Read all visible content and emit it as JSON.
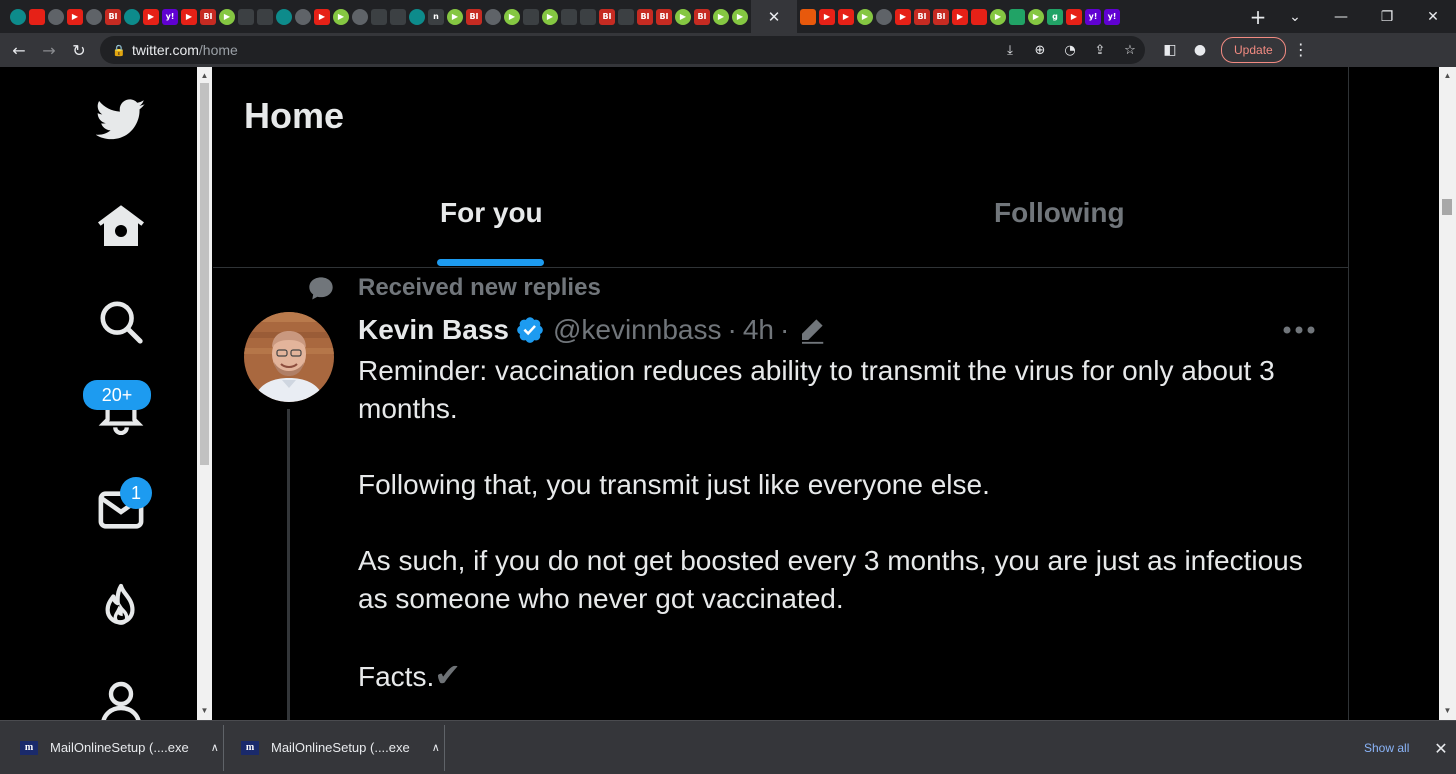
{
  "browser": {
    "tabs": [
      {
        "icon": "globe-favicon",
        "text": "",
        "cls": "teal"
      },
      {
        "icon": "red-favicon",
        "text": "",
        "cls": "yt"
      },
      {
        "icon": "globe-favicon",
        "text": "",
        "cls": "globe"
      },
      {
        "icon": "youtube-favicon",
        "text": "▶",
        "cls": "yt"
      },
      {
        "icon": "globe-favicon",
        "text": "",
        "cls": "globe"
      },
      {
        "icon": "business-insider-favicon",
        "text": "BI",
        "cls": "bi"
      },
      {
        "icon": "globe-favicon",
        "text": "",
        "cls": "teal"
      },
      {
        "icon": "youtube-favicon",
        "text": "▶",
        "cls": "yt"
      },
      {
        "icon": "yahoo-favicon",
        "text": "y!",
        "cls": "yahoo"
      },
      {
        "icon": "youtube-favicon",
        "text": "▶",
        "cls": "yt"
      },
      {
        "icon": "business-insider-favicon",
        "text": "BI",
        "cls": "bi"
      },
      {
        "icon": "rumble-favicon",
        "text": "▶",
        "cls": "rumble"
      },
      {
        "icon": "dark-favicon",
        "text": "",
        "cls": "dark"
      },
      {
        "icon": "dark-favicon",
        "text": "",
        "cls": "dark"
      },
      {
        "icon": "globe-favicon",
        "text": "",
        "cls": "teal"
      },
      {
        "icon": "globe-favicon",
        "text": "",
        "cls": "globe"
      },
      {
        "icon": "youtube-favicon",
        "text": "▶",
        "cls": "yt"
      },
      {
        "icon": "rumble-favicon",
        "text": "▶",
        "cls": "rumble"
      },
      {
        "icon": "globe-favicon",
        "text": "",
        "cls": "globe"
      },
      {
        "icon": "dark-favicon",
        "text": "",
        "cls": "dark"
      },
      {
        "icon": "search-favicon",
        "text": "",
        "cls": "dark"
      },
      {
        "icon": "globe-favicon",
        "text": "",
        "cls": "teal"
      },
      {
        "icon": "notion-favicon",
        "text": "n",
        "cls": "dark"
      },
      {
        "icon": "rumble-favicon",
        "text": "▶",
        "cls": "rumble"
      },
      {
        "icon": "business-insider-favicon",
        "text": "BI",
        "cls": "bi"
      },
      {
        "icon": "globe-favicon",
        "text": "",
        "cls": "globe"
      },
      {
        "icon": "rumble-favicon",
        "text": "▶",
        "cls": "rumble"
      },
      {
        "icon": "dark-favicon",
        "text": "",
        "cls": "dark"
      },
      {
        "icon": "rumble-favicon",
        "text": "▶",
        "cls": "rumble"
      },
      {
        "icon": "search-favicon",
        "text": "",
        "cls": "dark"
      },
      {
        "icon": "dark-favicon",
        "text": "",
        "cls": "dark"
      },
      {
        "icon": "business-insider-favicon",
        "text": "BI",
        "cls": "bi"
      },
      {
        "icon": "dark-favicon",
        "text": "",
        "cls": "dark"
      },
      {
        "icon": "business-insider-favicon",
        "text": "BI",
        "cls": "bi"
      },
      {
        "icon": "business-insider-favicon",
        "text": "BI",
        "cls": "bi"
      },
      {
        "icon": "rumble-favicon",
        "text": "▶",
        "cls": "rumble"
      },
      {
        "icon": "business-insider-favicon",
        "text": "BI",
        "cls": "bi"
      },
      {
        "icon": "rumble-favicon",
        "text": "▶",
        "cls": "rumble"
      },
      {
        "icon": "rumble-favicon",
        "text": "▶",
        "cls": "rumble"
      },
      {
        "icon": "close-icon",
        "text": "✕",
        "cls": "active"
      },
      {
        "icon": "substack-favicon",
        "text": "",
        "cls": "orange"
      },
      {
        "icon": "youtube-favicon",
        "text": "▶",
        "cls": "yt"
      },
      {
        "icon": "youtube-favicon",
        "text": "▶",
        "cls": "yt"
      },
      {
        "icon": "rumble-favicon",
        "text": "▶",
        "cls": "rumble"
      },
      {
        "icon": "globe-favicon",
        "text": "",
        "cls": "globe"
      },
      {
        "icon": "youtube-favicon",
        "text": "▶",
        "cls": "yt"
      },
      {
        "icon": "business-insider-favicon",
        "text": "BI",
        "cls": "bi"
      },
      {
        "icon": "business-insider-favicon",
        "text": "BI",
        "cls": "bi"
      },
      {
        "icon": "youtube-favicon",
        "text": "▶",
        "cls": "yt"
      },
      {
        "icon": "red-favicon",
        "text": "",
        "cls": "yt"
      },
      {
        "icon": "rumble-favicon",
        "text": "▶",
        "cls": "rumble"
      },
      {
        "icon": "green-favicon",
        "text": "",
        "cls": "green"
      },
      {
        "icon": "rumble-favicon",
        "text": "▶",
        "cls": "rumble"
      },
      {
        "icon": "green-favicon",
        "text": "g",
        "cls": "green"
      },
      {
        "icon": "youtube-favicon",
        "text": "▶",
        "cls": "yt"
      },
      {
        "icon": "yahoo-favicon",
        "text": "y!",
        "cls": "yahoo"
      },
      {
        "icon": "yahoo-favicon",
        "text": "y!",
        "cls": "yahoo"
      }
    ],
    "new_tab": "+",
    "url_host": "twitter.com",
    "url_path": "/home",
    "update_label": "Update",
    "accent": "#f28b82"
  },
  "sidebar": {
    "notifications_badge": "20+",
    "messages_badge": "1",
    "accent": "#1d9bf0"
  },
  "header": {
    "title": "Home",
    "tabs": [
      {
        "label": "For you",
        "selected": true
      },
      {
        "label": "Following",
        "selected": false
      }
    ]
  },
  "tweet": {
    "social_context": "Received new replies",
    "author_name": "Kevin Bass",
    "handle": "@kevinnbass",
    "separator": "·",
    "time": "4h",
    "paragraphs": [
      "Reminder: vaccination reduces ability to transmit the virus for only about 3 months.",
      "Following that, you transmit just like everyone else.",
      "As such, if you do not get boosted every 3 months, you are just as infectious as someone who never got vaccinated."
    ],
    "last_line": "Facts.",
    "last_emoji": "✔"
  },
  "downloads": {
    "items": [
      {
        "name": "MailOnlineSetup (....exe",
        "icon_text": "m"
      },
      {
        "name": "MailOnlineSetup (....exe",
        "icon_text": "m"
      }
    ],
    "show_all": "Show all"
  }
}
